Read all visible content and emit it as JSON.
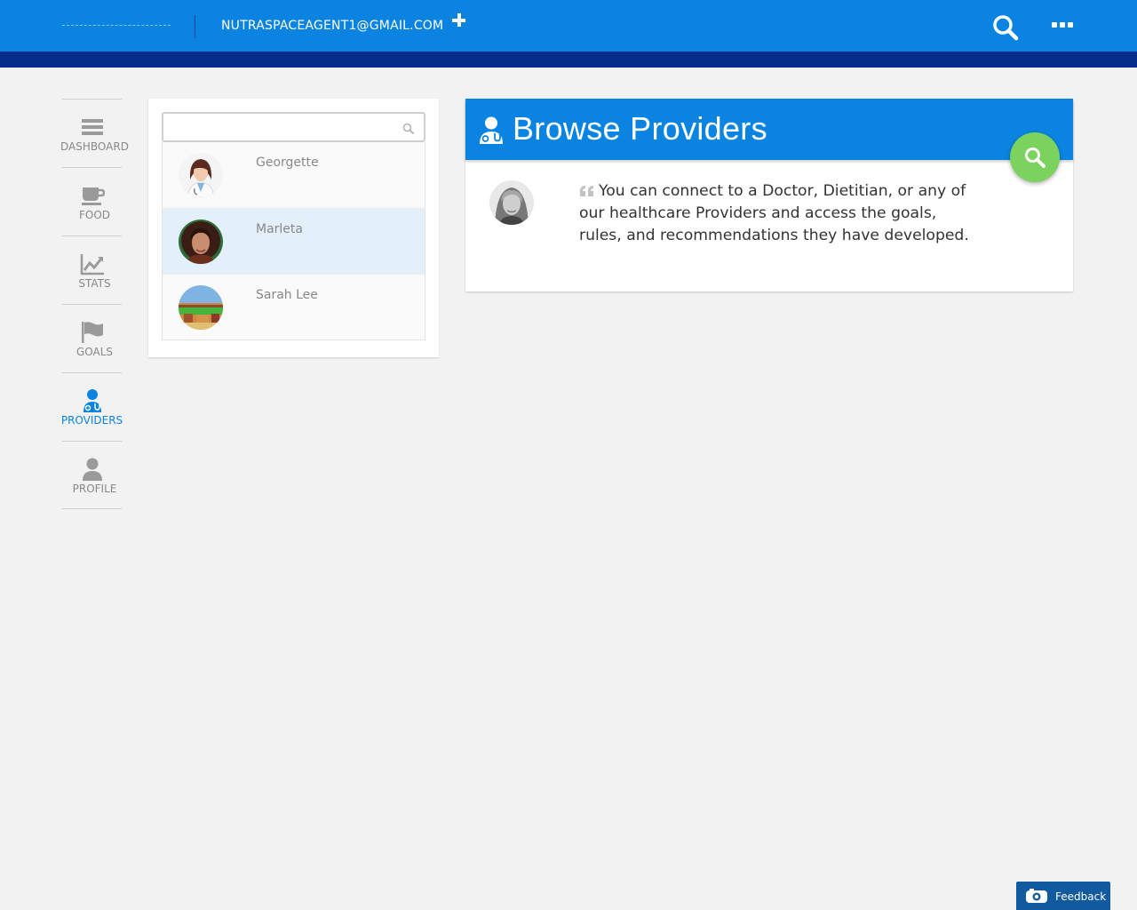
{
  "header": {
    "account_email": "NUTRASPACEAGENT1@GMAIL.COM",
    "add_icon": "plus-icon",
    "search_icon": "search-icon",
    "menu_icon": "more-dots-icon",
    "brand_color": "#0a84e0",
    "strip_color": "#062d8a"
  },
  "sidebar": {
    "items": [
      {
        "label": "DASHBOARD",
        "icon": "dashboard-bars-icon",
        "active": false
      },
      {
        "label": "FOOD",
        "icon": "coffee-cup-icon",
        "active": false
      },
      {
        "label": "STATS",
        "icon": "line-chart-icon",
        "active": false
      },
      {
        "label": "GOALS",
        "icon": "flag-icon",
        "active": false
      },
      {
        "label": "PROVIDERS",
        "icon": "doctor-icon",
        "active": true
      },
      {
        "label": "PROFILE",
        "icon": "user-icon",
        "active": false
      }
    ]
  },
  "provider_list": {
    "search": {
      "placeholder": "",
      "value": ""
    },
    "providers": [
      {
        "name": "Georgette",
        "selected": false
      },
      {
        "name": "Marleta",
        "selected": true
      },
      {
        "name": "Sarah Lee",
        "selected": false
      }
    ]
  },
  "browse": {
    "title": "Browse Providers",
    "description": "You can connect to a Doctor, Dietitian, or any of our healthcare Providers and access the goals, rules, and recommendations they have developed.",
    "fab_color": "#7bd25d"
  },
  "feedback": {
    "label": "Feedback"
  }
}
